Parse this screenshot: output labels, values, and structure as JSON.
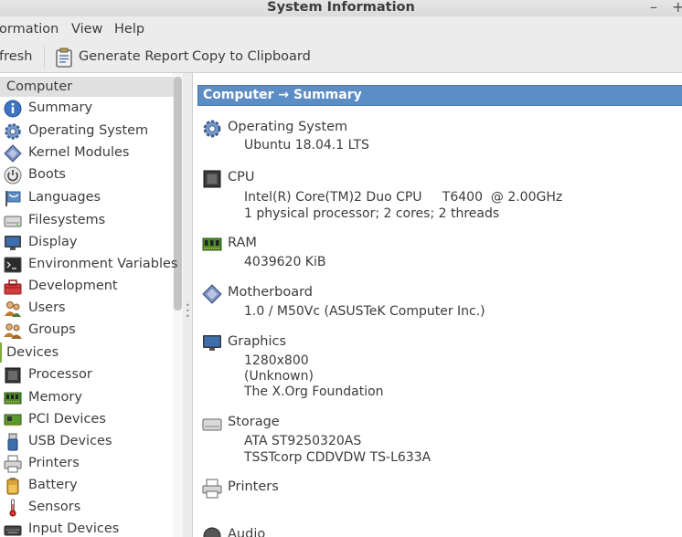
{
  "window": {
    "title": "System Information",
    "minimize_glyph": "–",
    "maximize_glyph": "+"
  },
  "menu": {
    "items": [
      "ormation",
      "View",
      "Help"
    ]
  },
  "toolbar": {
    "refresh_label": "fresh",
    "generate_report_label": "Generate Report",
    "copy_clipboard_label": "Copy to Clipboard"
  },
  "sidebar": {
    "computer_header": "Computer",
    "computer_items": [
      {
        "label": "Summary",
        "icon": "info-icon"
      },
      {
        "label": "Operating System",
        "icon": "gear-icon"
      },
      {
        "label": "Kernel Modules",
        "icon": "diamond-module-icon"
      },
      {
        "label": "Boots",
        "icon": "power-icon"
      },
      {
        "label": "Languages",
        "icon": "flag-icon"
      },
      {
        "label": "Filesystems",
        "icon": "drive-icon"
      },
      {
        "label": "Display",
        "icon": "monitor-icon"
      },
      {
        "label": "Environment Variables",
        "icon": "terminal-icon"
      },
      {
        "label": "Development",
        "icon": "toolbox-icon"
      },
      {
        "label": "Users",
        "icon": "users-icon"
      },
      {
        "label": "Groups",
        "icon": "groups-icon"
      }
    ],
    "devices_header": "Devices",
    "devices_items": [
      {
        "label": "Processor",
        "icon": "chip-icon"
      },
      {
        "label": "Memory",
        "icon": "ram-icon"
      },
      {
        "label": "PCI Devices",
        "icon": "pci-card-icon"
      },
      {
        "label": "USB Devices",
        "icon": "usb-icon"
      },
      {
        "label": "Printers",
        "icon": "printer-icon"
      },
      {
        "label": "Battery",
        "icon": "battery-icon"
      },
      {
        "label": "Sensors",
        "icon": "thermometer-icon"
      },
      {
        "label": "Input Devices",
        "icon": "keyboard-icon"
      }
    ]
  },
  "main": {
    "banner": "Computer → Summary",
    "sections": {
      "os": {
        "title": "Operating System",
        "lines": [
          "Ubuntu 18.04.1 LTS"
        ]
      },
      "cpu": {
        "title": "CPU",
        "lines": [
          "Intel(R) Core(TM)2 Duo CPU     T6400  @ 2.00GHz",
          "1 physical processor; 2 cores; 2 threads"
        ]
      },
      "ram": {
        "title": "RAM",
        "lines": [
          "4039620 KiB"
        ]
      },
      "motherboard": {
        "title": "Motherboard",
        "lines": [
          "1.0 / M50Vc (ASUSTeK Computer Inc.)"
        ]
      },
      "graphics": {
        "title": "Graphics",
        "lines": [
          "1280x800",
          "(Unknown)",
          "The X.Org Foundation"
        ]
      },
      "storage": {
        "title": "Storage",
        "lines": [
          "ATA ST9250320AS",
          "TSSTcorp CDDVDW TS-L633A"
        ]
      },
      "printers": {
        "title": "Printers",
        "lines": []
      },
      "audio": {
        "title": "Audio",
        "lines": []
      }
    }
  },
  "colors": {
    "banner_bg": "#5c8dc4",
    "devices_accent": "#7dad3a"
  }
}
